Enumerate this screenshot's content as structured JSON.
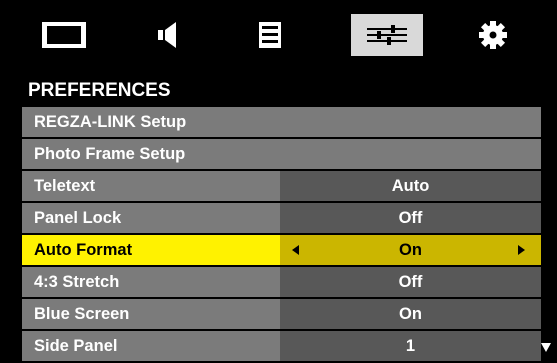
{
  "tabs": [
    {
      "icon": "picture-icon",
      "active": false
    },
    {
      "icon": "sound-icon",
      "active": false
    },
    {
      "icon": "setup-icon",
      "active": false
    },
    {
      "icon": "preferences-icon",
      "active": true
    },
    {
      "icon": "gear-icon",
      "active": false
    }
  ],
  "section_title": "PREFERENCES",
  "rows": [
    {
      "label": "REGZA-LINK Setup"
    },
    {
      "label": "Photo Frame Setup"
    },
    {
      "label": "Teletext",
      "value": "Auto"
    },
    {
      "label": "Panel Lock",
      "value": "Off"
    },
    {
      "label": "Auto Format",
      "value": "On",
      "selected": true
    },
    {
      "label": "4:3 Stretch",
      "value": "Off"
    },
    {
      "label": "Blue Screen",
      "value": "On"
    },
    {
      "label": "Side Panel",
      "value": "1"
    }
  ],
  "colors": {
    "row_bg": "#7b7b7b",
    "value_bg": "#585858",
    "highlight": "#fff200",
    "highlight_value": "#cbb600",
    "active_tab": "#d9d9d9"
  }
}
